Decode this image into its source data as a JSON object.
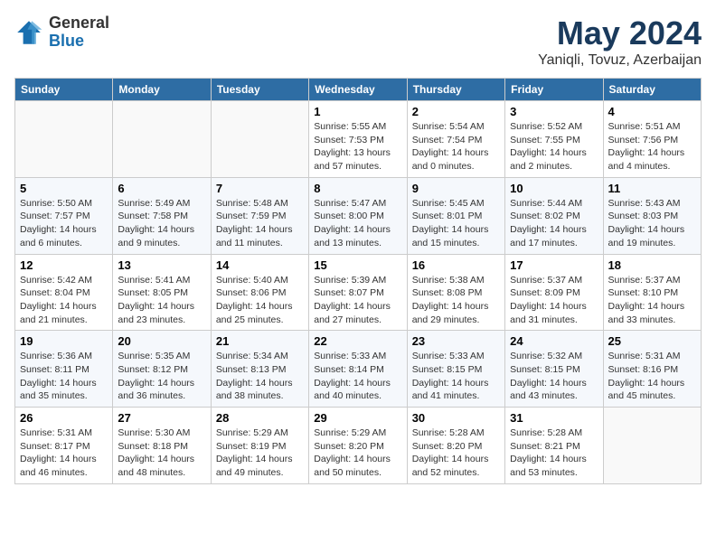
{
  "logo": {
    "general": "General",
    "blue": "Blue"
  },
  "title": {
    "month_year": "May 2024",
    "location": "Yaniqli, Tovuz, Azerbaijan"
  },
  "weekdays": [
    "Sunday",
    "Monday",
    "Tuesday",
    "Wednesday",
    "Thursday",
    "Friday",
    "Saturday"
  ],
  "weeks": [
    [
      {
        "day": "",
        "info": ""
      },
      {
        "day": "",
        "info": ""
      },
      {
        "day": "",
        "info": ""
      },
      {
        "day": "1",
        "info": "Sunrise: 5:55 AM\nSunset: 7:53 PM\nDaylight: 13 hours and 57 minutes."
      },
      {
        "day": "2",
        "info": "Sunrise: 5:54 AM\nSunset: 7:54 PM\nDaylight: 14 hours and 0 minutes."
      },
      {
        "day": "3",
        "info": "Sunrise: 5:52 AM\nSunset: 7:55 PM\nDaylight: 14 hours and 2 minutes."
      },
      {
        "day": "4",
        "info": "Sunrise: 5:51 AM\nSunset: 7:56 PM\nDaylight: 14 hours and 4 minutes."
      }
    ],
    [
      {
        "day": "5",
        "info": "Sunrise: 5:50 AM\nSunset: 7:57 PM\nDaylight: 14 hours and 6 minutes."
      },
      {
        "day": "6",
        "info": "Sunrise: 5:49 AM\nSunset: 7:58 PM\nDaylight: 14 hours and 9 minutes."
      },
      {
        "day": "7",
        "info": "Sunrise: 5:48 AM\nSunset: 7:59 PM\nDaylight: 14 hours and 11 minutes."
      },
      {
        "day": "8",
        "info": "Sunrise: 5:47 AM\nSunset: 8:00 PM\nDaylight: 14 hours and 13 minutes."
      },
      {
        "day": "9",
        "info": "Sunrise: 5:45 AM\nSunset: 8:01 PM\nDaylight: 14 hours and 15 minutes."
      },
      {
        "day": "10",
        "info": "Sunrise: 5:44 AM\nSunset: 8:02 PM\nDaylight: 14 hours and 17 minutes."
      },
      {
        "day": "11",
        "info": "Sunrise: 5:43 AM\nSunset: 8:03 PM\nDaylight: 14 hours and 19 minutes."
      }
    ],
    [
      {
        "day": "12",
        "info": "Sunrise: 5:42 AM\nSunset: 8:04 PM\nDaylight: 14 hours and 21 minutes."
      },
      {
        "day": "13",
        "info": "Sunrise: 5:41 AM\nSunset: 8:05 PM\nDaylight: 14 hours and 23 minutes."
      },
      {
        "day": "14",
        "info": "Sunrise: 5:40 AM\nSunset: 8:06 PM\nDaylight: 14 hours and 25 minutes."
      },
      {
        "day": "15",
        "info": "Sunrise: 5:39 AM\nSunset: 8:07 PM\nDaylight: 14 hours and 27 minutes."
      },
      {
        "day": "16",
        "info": "Sunrise: 5:38 AM\nSunset: 8:08 PM\nDaylight: 14 hours and 29 minutes."
      },
      {
        "day": "17",
        "info": "Sunrise: 5:37 AM\nSunset: 8:09 PM\nDaylight: 14 hours and 31 minutes."
      },
      {
        "day": "18",
        "info": "Sunrise: 5:37 AM\nSunset: 8:10 PM\nDaylight: 14 hours and 33 minutes."
      }
    ],
    [
      {
        "day": "19",
        "info": "Sunrise: 5:36 AM\nSunset: 8:11 PM\nDaylight: 14 hours and 35 minutes."
      },
      {
        "day": "20",
        "info": "Sunrise: 5:35 AM\nSunset: 8:12 PM\nDaylight: 14 hours and 36 minutes."
      },
      {
        "day": "21",
        "info": "Sunrise: 5:34 AM\nSunset: 8:13 PM\nDaylight: 14 hours and 38 minutes."
      },
      {
        "day": "22",
        "info": "Sunrise: 5:33 AM\nSunset: 8:14 PM\nDaylight: 14 hours and 40 minutes."
      },
      {
        "day": "23",
        "info": "Sunrise: 5:33 AM\nSunset: 8:15 PM\nDaylight: 14 hours and 41 minutes."
      },
      {
        "day": "24",
        "info": "Sunrise: 5:32 AM\nSunset: 8:15 PM\nDaylight: 14 hours and 43 minutes."
      },
      {
        "day": "25",
        "info": "Sunrise: 5:31 AM\nSunset: 8:16 PM\nDaylight: 14 hours and 45 minutes."
      }
    ],
    [
      {
        "day": "26",
        "info": "Sunrise: 5:31 AM\nSunset: 8:17 PM\nDaylight: 14 hours and 46 minutes."
      },
      {
        "day": "27",
        "info": "Sunrise: 5:30 AM\nSunset: 8:18 PM\nDaylight: 14 hours and 48 minutes."
      },
      {
        "day": "28",
        "info": "Sunrise: 5:29 AM\nSunset: 8:19 PM\nDaylight: 14 hours and 49 minutes."
      },
      {
        "day": "29",
        "info": "Sunrise: 5:29 AM\nSunset: 8:20 PM\nDaylight: 14 hours and 50 minutes."
      },
      {
        "day": "30",
        "info": "Sunrise: 5:28 AM\nSunset: 8:20 PM\nDaylight: 14 hours and 52 minutes."
      },
      {
        "day": "31",
        "info": "Sunrise: 5:28 AM\nSunset: 8:21 PM\nDaylight: 14 hours and 53 minutes."
      },
      {
        "day": "",
        "info": ""
      }
    ]
  ]
}
